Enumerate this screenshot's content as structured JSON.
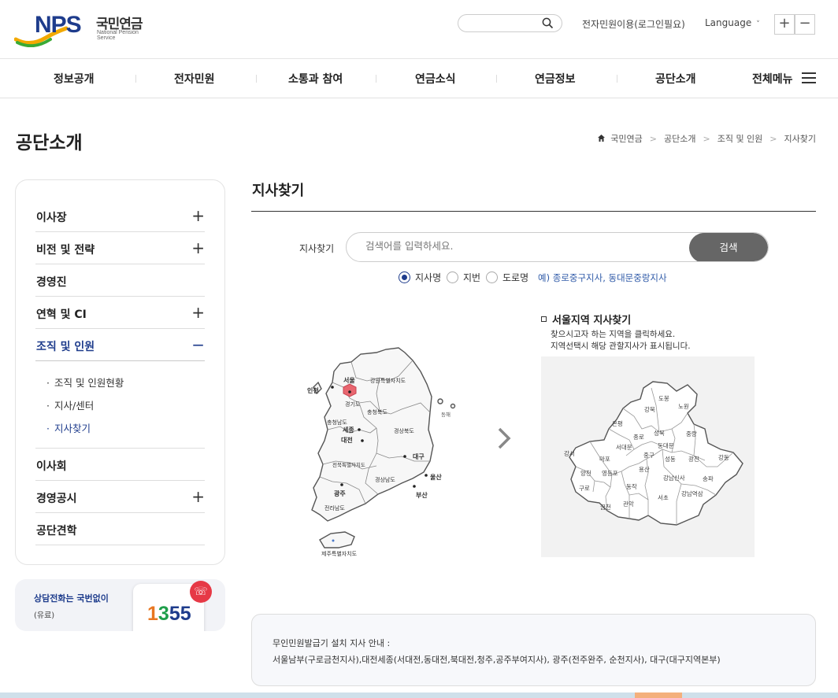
{
  "header": {
    "logo_text": "NPS",
    "logo_korean": "국민연금",
    "logo_english": "National Pension Service",
    "search_placeholder": "",
    "e_civil_link": "전자민원이용(로그인필요)",
    "language_label": "Language",
    "zoom_in": "+",
    "zoom_out": "−"
  },
  "gnb": {
    "items": [
      "정보공개",
      "전자민원",
      "소통과 참여",
      "연금소식",
      "연금정보",
      "공단소개",
      "전체메뉴"
    ]
  },
  "page": {
    "title": "공단소개",
    "breadcrumb": [
      "국민연금",
      "공단소개",
      "조직 및 인원",
      "지사찾기"
    ]
  },
  "lnb": {
    "items": [
      {
        "label": "이사장",
        "toggle": "+"
      },
      {
        "label": "비전 및 전략",
        "toggle": "+"
      },
      {
        "label": "경영진",
        "toggle": ""
      },
      {
        "label": "연혁 및 CI",
        "toggle": "+"
      },
      {
        "label": "조직 및 인원",
        "toggle": "−"
      },
      {
        "label": "이사회",
        "toggle": ""
      },
      {
        "label": "경영공시",
        "toggle": "+"
      },
      {
        "label": "공단견학",
        "toggle": ""
      }
    ],
    "sub_items": [
      "조직 및 인원현황",
      "지사/센터",
      "지사찾기"
    ]
  },
  "call": {
    "line1": "상담전화는 국번없이",
    "line2": "(유료)",
    "number_digits": [
      "1",
      "3",
      "5",
      "5"
    ],
    "number_colors": [
      "#e87722",
      "#1e9e4a",
      "#1e3c8c",
      "#1e3c8c"
    ]
  },
  "content": {
    "title": "지사찾기",
    "search_label": "지사찾기",
    "search_placeholder": "검색어를 입력하세요.",
    "search_button": "검색",
    "radios": [
      {
        "label": "지사명",
        "checked": true
      },
      {
        "label": "지번",
        "checked": false
      },
      {
        "label": "도로명",
        "checked": false
      }
    ],
    "example_prefix": "예) ",
    "example_text": "종로중구지사, 동대문중랑지사"
  },
  "korea_map": {
    "regions": [
      "서울",
      "인천",
      "강원특별자치도",
      "경기도",
      "충청북도",
      "충청남도",
      "세종",
      "대전",
      "경상북도",
      "대구",
      "전북특별자치도",
      "경상남도",
      "울산",
      "광주",
      "부산",
      "전라남도",
      "제주특별자치도",
      "동해"
    ]
  },
  "seoul_panel": {
    "title": "서울지역 지사찾기",
    "desc1": "찾으시고자 하는 지역을 클릭하세요.",
    "desc2": "지역선택시 해당 관할지사가 표시됩니다.",
    "districts": [
      "도봉",
      "노원",
      "강북",
      "은평",
      "성북",
      "중랑",
      "종로",
      "동대문",
      "서대문",
      "강서",
      "마포",
      "중구",
      "성동",
      "광진",
      "강동",
      "양천",
      "영등포",
      "용산",
      "강남신사",
      "송파",
      "구로",
      "동작",
      "서초",
      "강남역삼",
      "금천",
      "관악"
    ]
  },
  "notice": {
    "line1": "무인민원발급기 설치 지사 안내 :",
    "line2": "서울남부(구로금천지사),대전세종(서대전,동대전,북대전,청주,공주부여지사), 광주(전주완주, 순천지사), 대구(대구지역본부)"
  },
  "colors": {
    "brand": "#1e3c8c",
    "accent_red": "#e63946",
    "button_gray": "#666666"
  }
}
